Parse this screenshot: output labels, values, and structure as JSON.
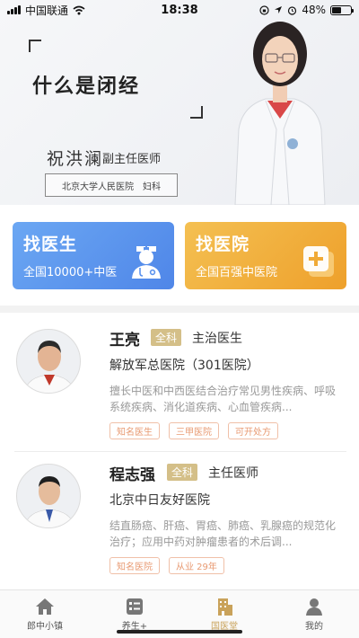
{
  "status_bar": {
    "carrier": "中国联通",
    "time": "18:38",
    "battery": "48%",
    "battery_level": 0.48
  },
  "banner": {
    "title": "什么是闭经",
    "doctor_name": "祝洪澜",
    "doctor_title": "副主任医师",
    "hospital": "北京大学人民医院",
    "department": "妇科"
  },
  "quick_cards": {
    "find_doctor": {
      "title": "找医生",
      "subtitle": "全国10000+中医",
      "color": "#5a92ee"
    },
    "find_hospital": {
      "title": "找医院",
      "subtitle": "全国百强中医院",
      "color": "#f0aa36"
    }
  },
  "doctors": [
    {
      "name": "王亮",
      "department": "全科",
      "rank": "主治医生",
      "hospital": "解放军总医院（301医院）",
      "specialty": "擅长中医和中西医结合治疗常见男性疾病、呼吸系统疾病、消化道疾病、心血管疾病...",
      "tags": [
        "知名医生",
        "三甲医院",
        "可开处方"
      ]
    },
    {
      "name": "程志强",
      "department": "全科",
      "rank": "主任医师",
      "hospital": "北京中日友好医院",
      "specialty": "结直肠癌、肝癌、胃癌、肺癌、乳腺癌的规范化治疗；应用中药对肿瘤患者的术后调...",
      "tags": [
        "知名医院",
        "从业 29年"
      ]
    }
  ],
  "tabs": [
    {
      "label": "郎中小镇",
      "icon": "home-icon"
    },
    {
      "label": "养生+",
      "icon": "checklist-icon"
    },
    {
      "label": "国医堂",
      "icon": "hospital-building-icon",
      "active": true
    },
    {
      "label": "我的",
      "icon": "profile-icon"
    }
  ],
  "colors": {
    "accent_gold": "#c9a25a",
    "badge_gold": "#d4bf88",
    "tag_orange": "#e89a72"
  }
}
